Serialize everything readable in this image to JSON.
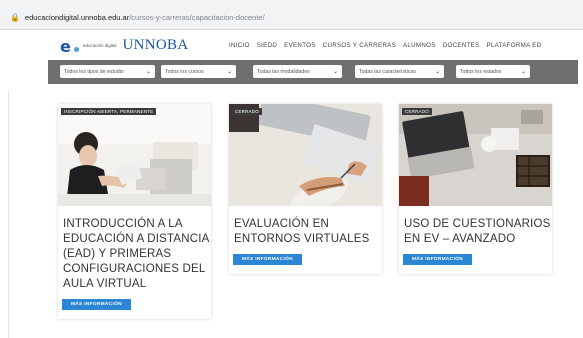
{
  "browser": {
    "url_domain": "educaciondigital.unnoba.edu.ar",
    "url_path": "/cursos-y-carreras/capacitacion-docente/"
  },
  "header": {
    "logo_subtext": "educación digital",
    "brand": "UNNOBA",
    "menu": [
      "INICIO",
      "SIEDD",
      "EVENTOS",
      "CURSOS Y CARRERAS",
      "ALUMNOS",
      "DOCENTES",
      "PLATAFORMA ED"
    ]
  },
  "filters": [
    "Todos los tipos de estudio",
    "Todos los cursos",
    "Todas las modalidades",
    "Todas las características",
    "Todos los estados"
  ],
  "cards": [
    {
      "badge": "INSCRIPCIÓN ABIERTA, PERMANENTE",
      "title": "INTRODUCCIÓN A LA EDUCACIÓN A DISTANCIA (EAD) Y PRIMERAS CONFIGURACIONES DEL AULA VIRTUAL",
      "button": "MÁS INFORMACIÓN"
    },
    {
      "badge": "CERRADO",
      "title": "EVALUACIÓN EN ENTORNOS VIRTUALES",
      "button": "MÁS INFORMACIÓN"
    },
    {
      "badge": "CERRADO",
      "title": "USO DE CUESTIONARIOS EN EV – AVANZADO",
      "button": "MÁS INFORMACIÓN"
    }
  ],
  "colors": {
    "brand_blue": "#1a56a6",
    "button_blue": "#2c86d6",
    "filter_bar": "#6f6f6f"
  }
}
